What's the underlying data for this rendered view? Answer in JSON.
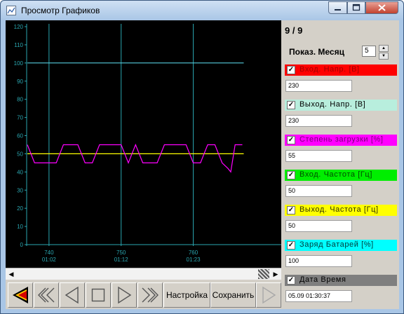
{
  "window": {
    "title": "Просмотр Графиков",
    "icon": "chart-app-icon",
    "controls": [
      "minimize-icon",
      "maximize-icon",
      "close-icon"
    ]
  },
  "chart_data": {
    "type": "line",
    "background": "#000000",
    "grid_color": "#2aa6b0",
    "ylim": [
      0,
      120
    ],
    "y_ticks": [
      "0",
      "10",
      "20",
      "30",
      "40",
      "50",
      "60",
      "70",
      "80",
      "90",
      "100",
      "110",
      "120"
    ],
    "x_ticks": [
      {
        "x": 740,
        "label": "740",
        "sub": "01:02"
      },
      {
        "x": 750,
        "label": "750",
        "sub": "01:12"
      },
      {
        "x": 760,
        "label": "760",
        "sub": "01:23"
      }
    ],
    "xlim": [
      736.9,
      772.2
    ],
    "series": [
      {
        "color": "#55ccdd",
        "x": [
          737,
          767
        ],
        "values": [
          100,
          100
        ]
      },
      {
        "color": "#ffff00",
        "x": [
          737,
          767
        ],
        "values": [
          50,
          50
        ]
      },
      {
        "color": "#ff00ff",
        "x": [
          737,
          738,
          741,
          742,
          744,
          745,
          746,
          747,
          750,
          751,
          752,
          753,
          755,
          756,
          759,
          760,
          761,
          762,
          763,
          764,
          764.8,
          765.2,
          765.8,
          766.8
        ],
        "values": [
          55,
          45,
          45,
          55,
          55,
          45,
          45,
          55,
          55,
          45,
          55,
          45,
          45,
          55,
          55,
          45,
          45,
          55,
          55,
          45,
          42,
          40,
          55,
          55
        ]
      }
    ]
  },
  "scrollbar": {
    "left_arrow": "◀",
    "right_arrow": "▶"
  },
  "toolbar": {
    "buttons": [
      {
        "name": "exit-button",
        "icon": "exit-icon"
      },
      {
        "name": "rewind-button",
        "icon": "double-left-icon"
      },
      {
        "name": "back-button",
        "icon": "triangle-left-icon"
      },
      {
        "name": "stop-button",
        "icon": "square-icon"
      },
      {
        "name": "play-button",
        "icon": "triangle-right-icon"
      },
      {
        "name": "forward-button",
        "icon": "double-right-icon"
      },
      {
        "name": "next-button",
        "icon": "triangle-right-icon"
      }
    ],
    "settings_label": "Настройка",
    "save_label": "Сохранить"
  },
  "panel": {
    "counter": "9 / 9",
    "month_label": "Показ. Месяц",
    "month_value": "5",
    "spin_up": "▲",
    "spin_down": "▼",
    "check": "✓",
    "groups": [
      {
        "label": "Вход. Напр. [В]",
        "color": "#ff0000",
        "text_color": "#a00000",
        "value": "230"
      },
      {
        "label": "Выход. Напр. [В]",
        "color": "#b8eedd",
        "text_color": "#000000",
        "value": "230"
      },
      {
        "label": "Степень загрузки [%]",
        "color": "#ff00ff",
        "text_color": "#7a007a",
        "value": "55"
      },
      {
        "label": "Вход. Частота [Гц]",
        "color": "#00ee00",
        "text_color": "#004d00",
        "value": "50"
      },
      {
        "label": "Выход. Частота [Гц]",
        "color": "#ffff00",
        "text_color": "#333300",
        "value": "50"
      },
      {
        "label": "Заряд Батарей [%]",
        "color": "#00ffff",
        "text_color": "#003c3c",
        "value": "100"
      },
      {
        "label": "Дата Время",
        "color": "#7f7f7f",
        "text_color": "#000000",
        "value": "05.09 01:30:37"
      }
    ]
  }
}
